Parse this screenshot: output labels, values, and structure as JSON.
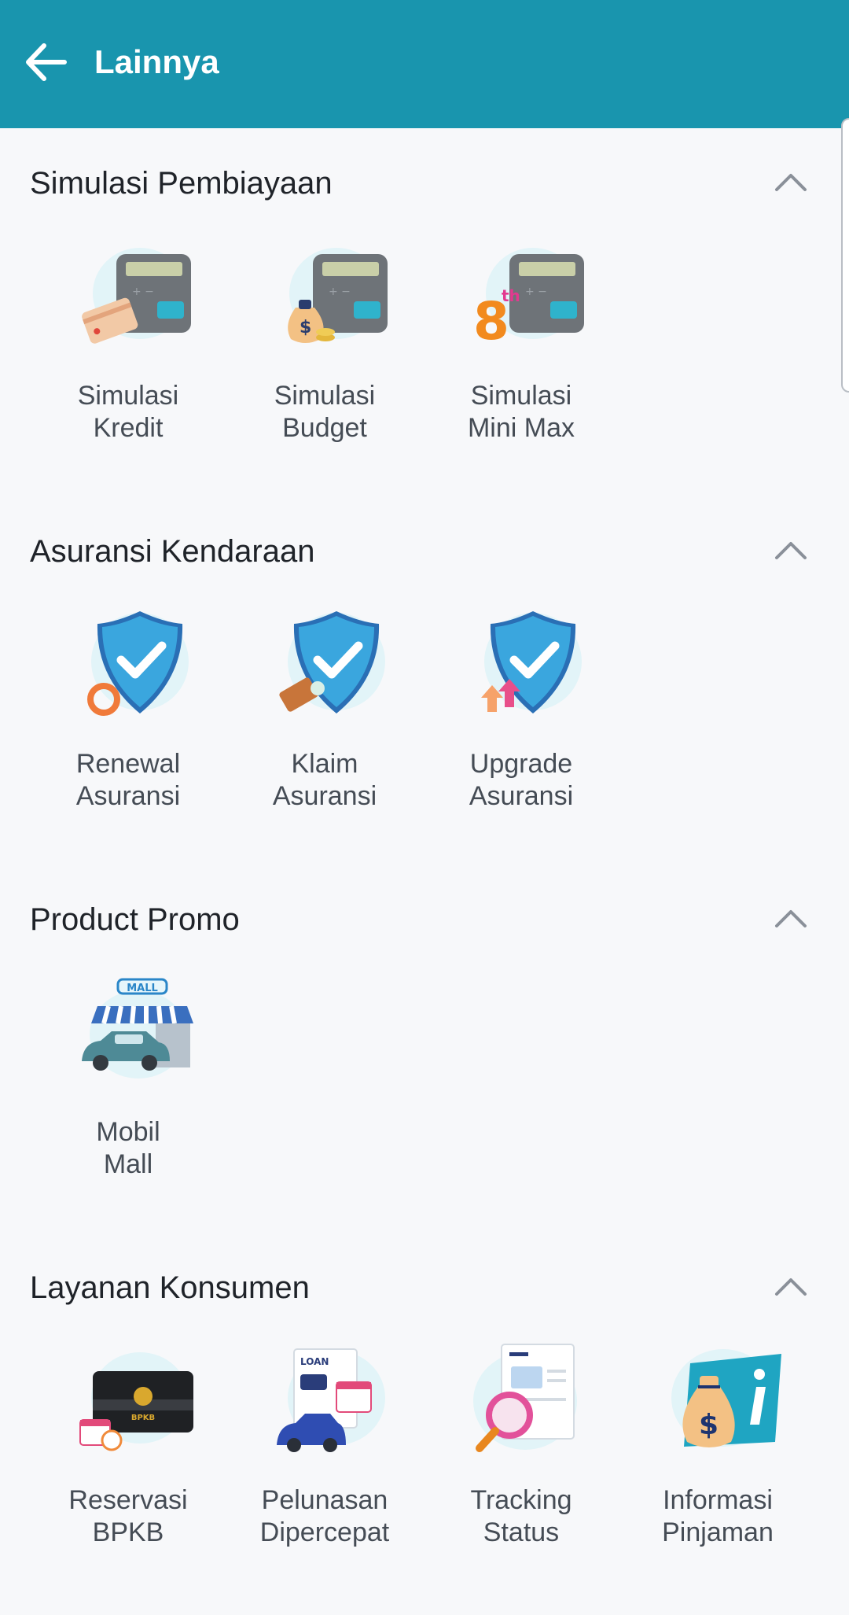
{
  "header": {
    "title": "Lainnya",
    "back_icon": "arrow-left-icon"
  },
  "colors": {
    "appbar": "#1995ae",
    "background": "#f7f8fa",
    "title_text": "#1f2329",
    "label_text": "#454c55"
  },
  "sections": [
    {
      "title": "Simulasi Pembiayaan",
      "expanded": true,
      "items": [
        {
          "line1": "Simulasi",
          "line2": "Kredit",
          "icon": "calculator-card-icon"
        },
        {
          "line1": "Simulasi",
          "line2": "Budget",
          "icon": "calculator-moneybag-icon"
        },
        {
          "line1": "Simulasi",
          "line2": "Mini Max",
          "icon": "calculator-8th-icon"
        }
      ]
    },
    {
      "title": "Asuransi Kendaraan",
      "expanded": true,
      "items": [
        {
          "line1": "Renewal",
          "line2": "Asuransi",
          "icon": "shield-renew-icon"
        },
        {
          "line1": "Klaim",
          "line2": "Asuransi",
          "icon": "shield-claim-icon"
        },
        {
          "line1": "Upgrade",
          "line2": "Asuransi",
          "icon": "shield-upgrade-icon"
        }
      ]
    },
    {
      "title": "Product Promo",
      "expanded": true,
      "items": [
        {
          "line1": "Mobil",
          "line2": "Mall",
          "icon": "car-mall-icon",
          "badge": "MALL"
        }
      ]
    },
    {
      "title": "Layanan Konsumen",
      "expanded": true,
      "items": [
        {
          "line1": "Reservasi",
          "line2": "BPKB",
          "icon": "bpkb-book-icon",
          "badge": "BPKB"
        },
        {
          "line1": "Pelunasan",
          "line2": "Dipercepat",
          "icon": "loan-document-icon",
          "badge": "LOAN"
        },
        {
          "line1": "Tracking",
          "line2": "Status",
          "icon": "magnifier-document-icon"
        },
        {
          "line1": "Informasi",
          "line2": "Pinjaman",
          "icon": "moneybag-info-icon"
        }
      ]
    }
  ]
}
